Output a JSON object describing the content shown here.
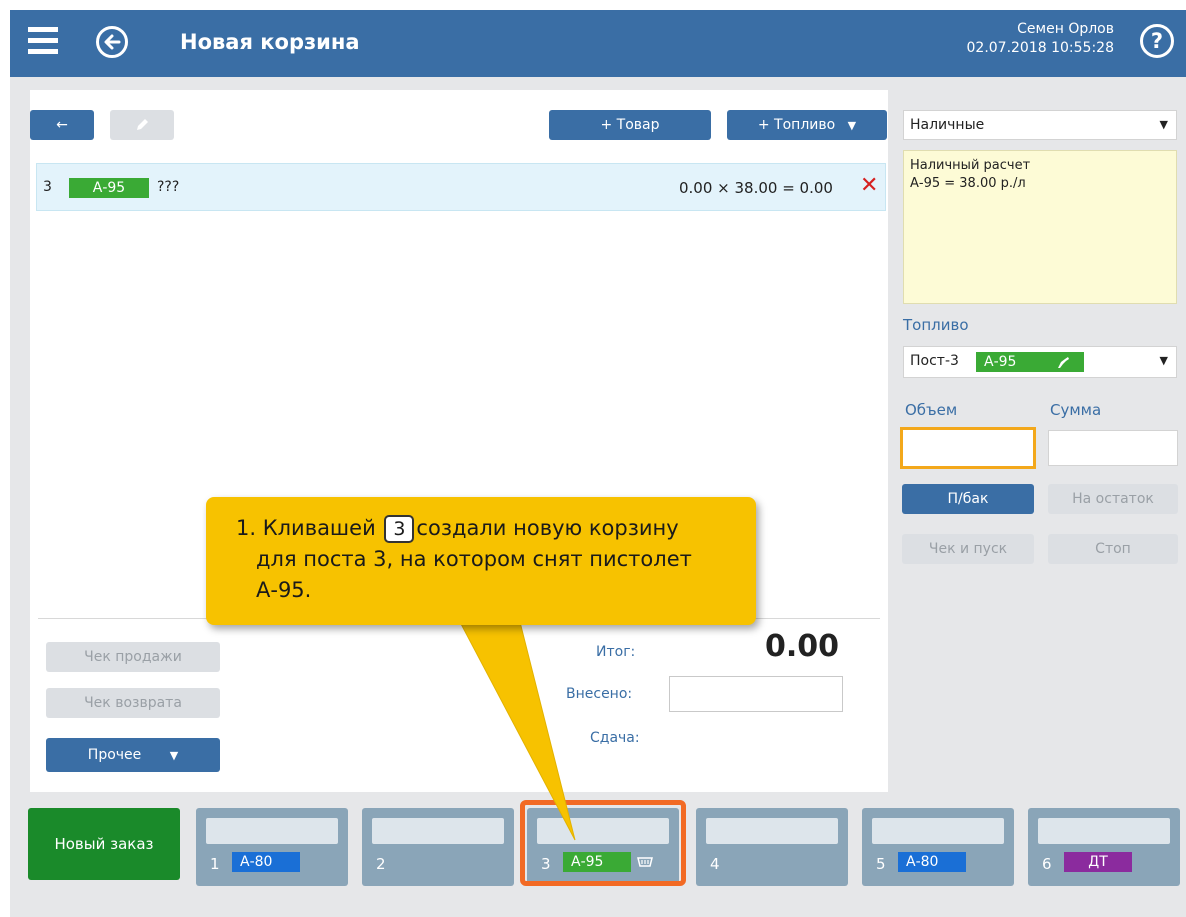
{
  "header": {
    "title": "Новая корзина",
    "user_name": "Семен Орлов",
    "datetime": "02.07.2018 10:55:28",
    "help_label": "?",
    "menu_icon": "hamburger-menu-icon",
    "back_icon": "back-arrow-circle-icon"
  },
  "toolbar": {
    "back_label": "←",
    "edit_icon": "pencil-icon",
    "add_product_label": "+ Товар",
    "add_fuel_label": "+ Топливо",
    "add_fuel_arrow": "▼"
  },
  "basket": {
    "rows": [
      {
        "post": "3",
        "fuel": "А-95",
        "name": "???",
        "calc": "0.00 × 38.00 = 0.00",
        "remove_icon": "✕"
      }
    ]
  },
  "totals": {
    "total_label": "Итог:",
    "total_value": "0.00",
    "paid_label": "Внесено:",
    "paid_value": "",
    "change_label": "Сдача:"
  },
  "actions": {
    "sale_receipt_label": "Чек продажи",
    "return_receipt_label": "Чек возврата",
    "other_label": "Прочее",
    "other_arrow": "▼"
  },
  "payment": {
    "selected": "Наличные",
    "arrow": "▼",
    "info_lines": [
      "Наличный расчет",
      "А-95 = 38.00 р./л"
    ]
  },
  "fuel": {
    "section_label": "Топливо",
    "post_label": "Пост-3",
    "fuel_tag": "А-95",
    "nozzle_icon": "fuel-nozzle-icon",
    "arrow": "▼",
    "volume_label": "Объем",
    "sum_label": "Сумма",
    "volume_value": "",
    "sum_value": "",
    "full_tank_label": "П/бак",
    "remainder_label": "На остаток",
    "check_start_label": "Чек и пуск",
    "stop_label": "Стоп"
  },
  "bottom": {
    "new_order_label": "Новый заказ",
    "posts": [
      {
        "num": "1",
        "fuel": "А-80",
        "color": "blue"
      },
      {
        "num": "2",
        "fuel": "",
        "color": ""
      },
      {
        "num": "3",
        "fuel": "А-95",
        "color": "green",
        "basket_icon": "basket-icon",
        "selected": true
      },
      {
        "num": "4",
        "fuel": "",
        "color": ""
      },
      {
        "num": "5",
        "fuel": "А-80",
        "color": "blue"
      },
      {
        "num": "6",
        "fuel": "ДТ",
        "color": "purple"
      }
    ]
  },
  "tooltip": {
    "line1_prefix": "1. Кливашей",
    "key": "3",
    "line1_suffix": "создали новую корзину",
    "line2": "для поста 3, на котором снят пистолет",
    "line3": "А-95."
  },
  "colors": {
    "header_bg": "#3a6ea5",
    "accent_blue": "#3a6ea5",
    "fuel_green": "#3aaa35",
    "fuel_blue": "#1a6fd6",
    "fuel_purple": "#8b2b9e",
    "new_order_green": "#1a8a2a",
    "tooltip_yellow": "#f7c200",
    "selected_orange": "#f26a24",
    "remove_red": "#d62020",
    "info_bg": "#fdfbd6"
  }
}
